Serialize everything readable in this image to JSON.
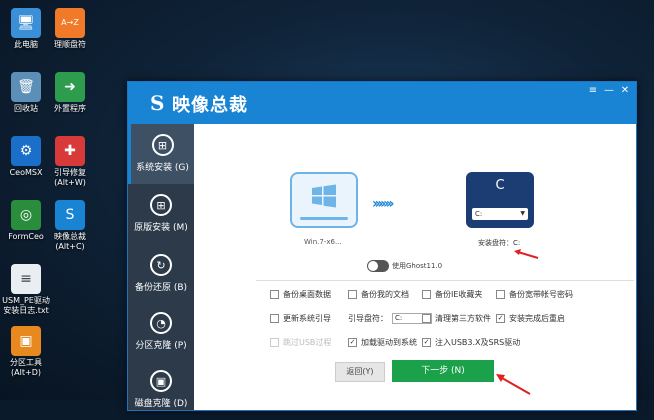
{
  "desktop": {
    "icons": [
      {
        "name": "desktop-icon-this-pc",
        "label": "此电脑",
        "glyph": "🖥",
        "color": "#3a8fd6"
      },
      {
        "name": "desktop-icon-partition",
        "label": "理顺盘符",
        "glyph": "A→Z",
        "color": "#f07a28"
      },
      {
        "name": "desktop-icon-recycle",
        "label": "回收站",
        "glyph": "🗑",
        "color": "#5c8fb8"
      },
      {
        "name": "desktop-icon-external",
        "label": "外置程序",
        "glyph": "➜",
        "color": "#2d9c4d"
      },
      {
        "name": "desktop-icon-ceomsx",
        "label": "CeoMSX",
        "glyph": "⚙",
        "color": "#1c6fc8"
      },
      {
        "name": "desktop-icon-boot-repair",
        "label": "引导修复\n(Alt+W)",
        "glyph": "✚",
        "color": "#d83a3a"
      },
      {
        "name": "desktop-icon-formceo",
        "label": "FormCeo",
        "glyph": "◎",
        "color": "#2a8d3c"
      },
      {
        "name": "desktop-icon-image-master",
        "label": "映像总裁\n(Alt+C)",
        "glyph": "S",
        "color": "#1a84d4"
      },
      {
        "name": "desktop-icon-usb-log",
        "label": "USM_PE驱动\n安装日志.txt",
        "glyph": "≡",
        "color": "#e9eef3"
      },
      {
        "name": "desktop-icon-partition-tool",
        "label": "分区工具\n(Alt+D)",
        "glyph": "▣",
        "color": "#e8891f"
      }
    ]
  },
  "window": {
    "title": "映像总裁",
    "buttons": {
      "menu": "≡",
      "minimize": "—",
      "close": "✕"
    }
  },
  "sidebar": {
    "items": [
      {
        "label": "系统安装 (G)",
        "icon": "⊞",
        "active": true
      },
      {
        "label": "原版安装 (M)",
        "icon": "⊞",
        "active": false
      },
      {
        "label": "备份还原 (B)",
        "icon": "↻",
        "active": false
      },
      {
        "label": "分区克隆 (P)",
        "icon": "◔",
        "active": false
      },
      {
        "label": "磁盘克隆 (D)",
        "icon": "▣",
        "active": false
      }
    ]
  },
  "main": {
    "source_caption": "Win.7-x6...",
    "target_letter": "C",
    "target_select": "C:",
    "target_caption": "安装盘符：C:",
    "arrows": "›››››››",
    "ghost_toggle_label": "使用Ghost11.0",
    "options": {
      "backup_desktop": {
        "label": "备份桌面数据",
        "checked": false
      },
      "backup_docs": {
        "label": "备份我的文档",
        "checked": false
      },
      "backup_ie": {
        "label": "备份IE收藏夹",
        "checked": false
      },
      "backup_broadband": {
        "label": "备份宽带帐号密码",
        "checked": false
      },
      "update_boot": {
        "label": "更新系统引导",
        "checked": false
      },
      "boot_drive_label": "引导盘符：",
      "boot_drive_value": "C:",
      "clean_third_party": {
        "label": "清理第三方软件",
        "checked": false
      },
      "restart_after": {
        "label": "安装完成后重启",
        "checked": true
      },
      "skip_usb": {
        "label": "跳过USB过程",
        "checked": false
      },
      "load_drivers": {
        "label": "加载驱动到系统",
        "checked": true
      },
      "inject_usb3": {
        "label": "注入USB3.X及SRS驱动",
        "checked": true
      }
    },
    "back_label": "返回(Y)",
    "next_label": "下一步 (N)"
  },
  "colors": {
    "accent": "#1a84d4",
    "sidebar": "#2c3a4a",
    "next": "#1aa14a",
    "drive_dark": "#1b3d73",
    "arrow_red": "#e02020"
  }
}
